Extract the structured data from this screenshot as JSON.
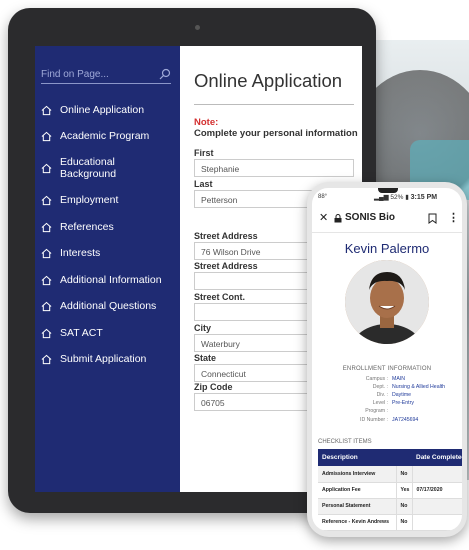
{
  "sidebar": {
    "search_placeholder": "Find on Page...",
    "items": [
      {
        "label": "Online Application"
      },
      {
        "label": "Academic Program"
      },
      {
        "label": "Educational Background"
      },
      {
        "label": "Employment"
      },
      {
        "label": "References"
      },
      {
        "label": "Interests"
      },
      {
        "label": "Additional Information"
      },
      {
        "label": "Additional Questions"
      },
      {
        "label": "SAT ACT"
      },
      {
        "label": "Submit Application"
      }
    ]
  },
  "form": {
    "title": "Online Application",
    "note_label": "Note:",
    "note_text": "Complete your personal information",
    "fields": [
      {
        "label": "First",
        "value": "Stephanie"
      },
      {
        "label": "Last",
        "value": "Petterson"
      },
      {
        "label": "Street Address",
        "value": "76 Wilson Drive"
      },
      {
        "label": "Street Address",
        "value": ""
      },
      {
        "label": "Street Cont.",
        "value": ""
      },
      {
        "label": "City",
        "value": "Waterbury"
      },
      {
        "label": "State",
        "value": "Connecticut"
      },
      {
        "label": "Zip Code",
        "value": "06705"
      }
    ]
  },
  "phone": {
    "status": {
      "left": "88°",
      "right": "52%",
      "time": "3:15 PM"
    },
    "browser_title": "SONIS Bio",
    "student_name": "Kevin Palermo",
    "enrollment_heading": "ENROLLMENT INFORMATION",
    "enrollment": [
      {
        "label": "Campus :",
        "value": "MAIN"
      },
      {
        "label": "Dept. :",
        "value": "Nursing & Allied Health"
      },
      {
        "label": "Div. :",
        "value": "Daytime"
      },
      {
        "label": "Level :",
        "value": "Pre-Entry"
      },
      {
        "label": "Program :",
        "value": ""
      },
      {
        "label": "ID Number :",
        "value": "JA7245694"
      }
    ],
    "checklist_heading": "CHECKLIST ITEMS",
    "checklist_columns": [
      "Description",
      "",
      "Date Completed"
    ],
    "checklist_rows": [
      {
        "desc": "Admissions Interview",
        "status": "No",
        "date": ""
      },
      {
        "desc": "Application Fee",
        "status": "Yes",
        "date": "07/17/2020"
      },
      {
        "desc": "Personal Statement",
        "status": "No",
        "date": ""
      },
      {
        "desc": "Reference - Kevin Andrews",
        "status": "No",
        "date": ""
      }
    ]
  },
  "colors": {
    "sidebar": "#1f2b73",
    "accent": "#1f2b73",
    "note": "#d32f2f"
  }
}
